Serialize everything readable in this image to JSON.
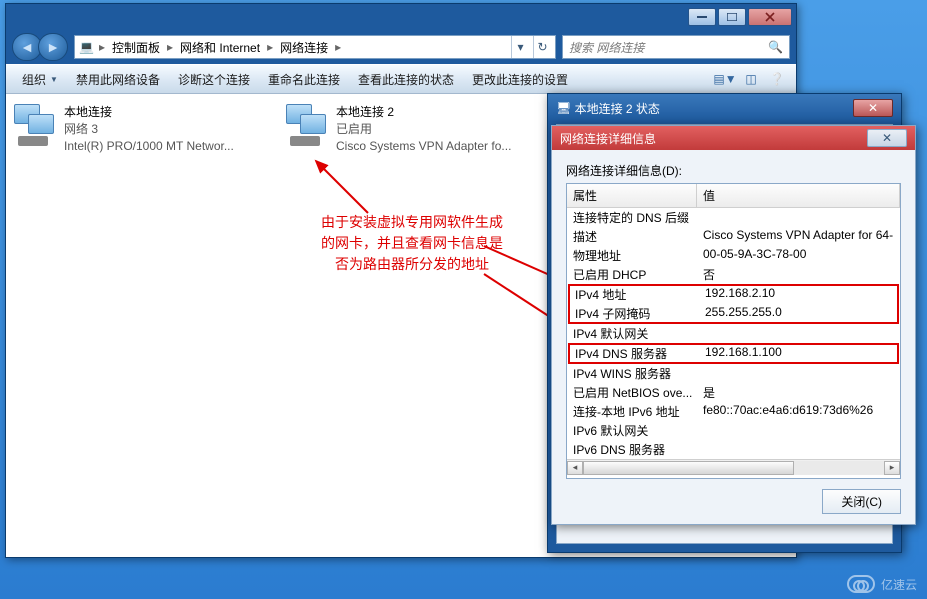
{
  "window": {
    "breadcrumb": [
      "控制面板",
      "网络和 Internet",
      "网络连接"
    ],
    "search_placeholder": "搜索 网络连接"
  },
  "toolbar": {
    "organize": "组织",
    "disable": "禁用此网络设备",
    "diagnose": "诊断这个连接",
    "rename": "重命名此连接",
    "viewstatus": "查看此连接的状态",
    "changesettings": "更改此连接的设置"
  },
  "connections": [
    {
      "name": "本地连接",
      "line2": "网络  3",
      "line3": "Intel(R) PRO/1000 MT Networ..."
    },
    {
      "name": "本地连接 2",
      "line2": "已启用",
      "line3": "Cisco Systems VPN Adapter fo..."
    }
  ],
  "annotation": "由于安装虚拟专用网软件生成的网卡，并且查看网卡信息是否为路由器所分发的地址",
  "status_dialog": {
    "title": "本地连接 2 状态"
  },
  "detail_dialog": {
    "title": "网络连接详细信息",
    "field_label": "网络连接详细信息(D):",
    "col_property": "属性",
    "col_value": "值",
    "rows": [
      {
        "p": "连接特定的 DNS 后缀",
        "v": ""
      },
      {
        "p": "描述",
        "v": "Cisco Systems VPN Adapter for 64-"
      },
      {
        "p": "物理地址",
        "v": "00-05-9A-3C-78-00"
      },
      {
        "p": "已启用 DHCP",
        "v": "否"
      },
      {
        "p": "IPv4 地址",
        "v": "192.168.2.10",
        "box": "a"
      },
      {
        "p": "IPv4 子网掩码",
        "v": "255.255.255.0",
        "box": "a"
      },
      {
        "p": "IPv4 默认网关",
        "v": ""
      },
      {
        "p": "IPv4 DNS 服务器",
        "v": "192.168.1.100",
        "box": "b"
      },
      {
        "p": "IPv4 WINS 服务器",
        "v": ""
      },
      {
        "p": "已启用 NetBIOS ove...",
        "v": "是"
      },
      {
        "p": "连接-本地 IPv6 地址",
        "v": "fe80::70ac:e4a6:d619:73d6%26"
      },
      {
        "p": "IPv6 默认网关",
        "v": ""
      },
      {
        "p": "IPv6 DNS 服务器",
        "v": ""
      }
    ],
    "close_btn": "关闭(C)"
  },
  "watermark": "亿速云"
}
